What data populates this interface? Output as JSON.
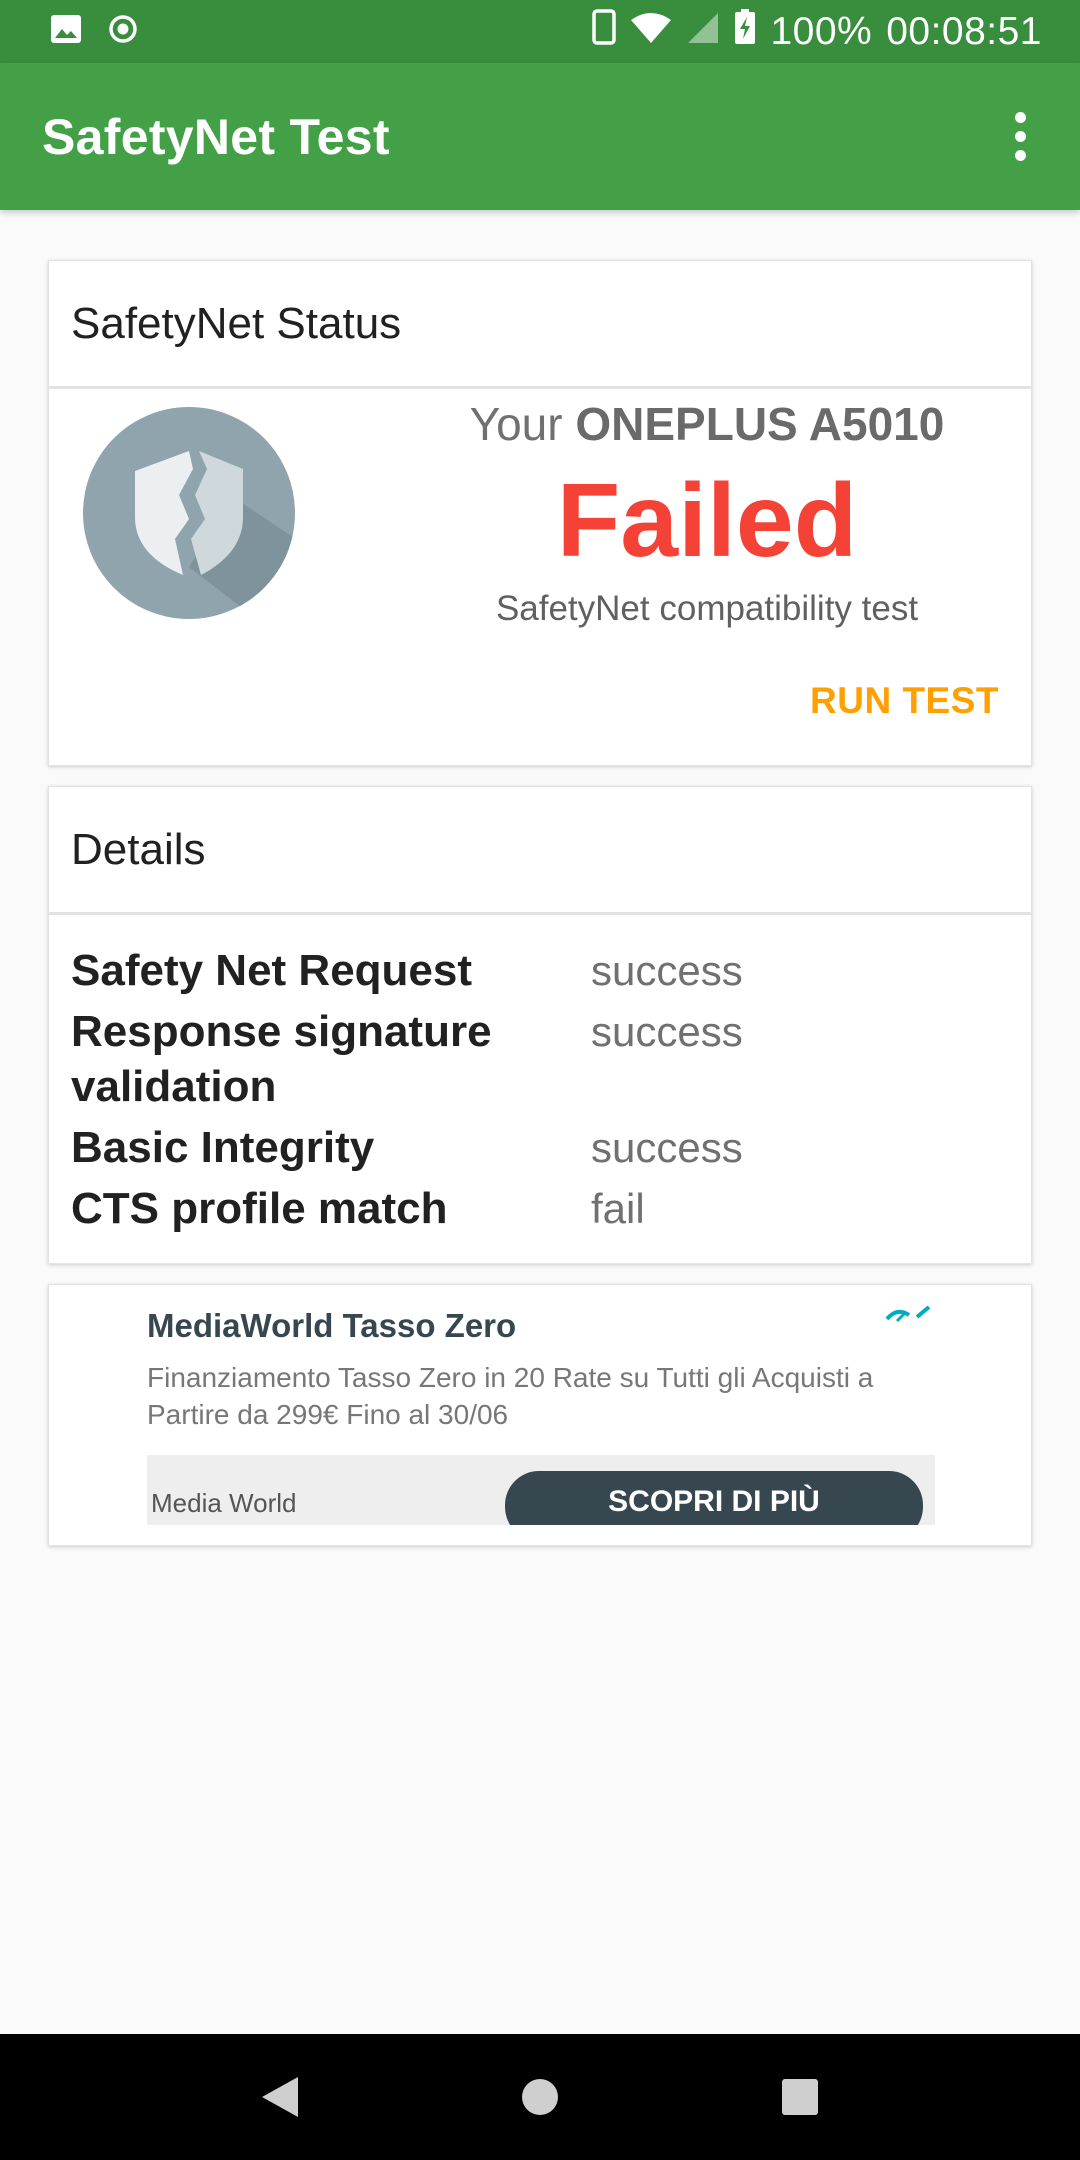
{
  "status_bar": {
    "battery": "100%",
    "time": "00:08:51"
  },
  "app_bar": {
    "title": "SafetyNet Test"
  },
  "status_card": {
    "header": "SafetyNet Status",
    "device_prefix": "Your ",
    "device_name": "ONEPLUS A5010",
    "result": "Failed",
    "result_color": "#f44336",
    "subtitle": "SafetyNet compatibility test",
    "run_test_label": "RUN TEST"
  },
  "details_card": {
    "header": "Details",
    "rows": [
      {
        "label": "Safety Net Request",
        "value": "success"
      },
      {
        "label": "Response signature validation",
        "value": "success"
      },
      {
        "label": "Basic Integrity",
        "value": "success"
      },
      {
        "label": "CTS profile match",
        "value": "fail"
      }
    ]
  },
  "ad": {
    "title": "MediaWorld Tasso Zero",
    "text": "Finanziamento Tasso Zero in 20 Rate su Tutti gli Acquisti a Partire da 299€ Fino al 30/06",
    "brand": "Media World",
    "cta": "SCOPRI DI PIÙ"
  },
  "colors": {
    "status_bar": "#388e3c",
    "app_bar": "#43a047",
    "accent": "#ffa000",
    "failed": "#f44336"
  }
}
